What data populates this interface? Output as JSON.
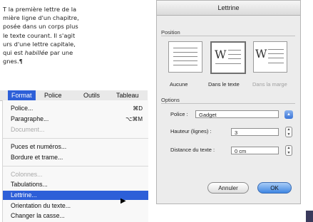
{
  "document": {
    "line1": "T la première lettre de la",
    "line2": "mière ligne d'un chapitre,",
    "line3": "posée dans un corps plus",
    "line4": "le texte courant. Il s'agit",
    "line5": "urs d'une lettre capitale,",
    "line6_before": "qui est ",
    "line6_em": "habillée",
    "line6_after": " par une",
    "line7": "gnes.¶"
  },
  "menubar": {
    "format": "Format",
    "police": "Police",
    "outils": "Outils",
    "tableau": "Tableau"
  },
  "menu": {
    "items": [
      {
        "label": "Police...",
        "shortcut": "⌘D"
      },
      {
        "label": "Paragraphe...",
        "shortcut": "⌥⌘M"
      },
      {
        "label": "Document...",
        "shortcut": ""
      },
      {
        "label": "Puces et numéros...",
        "shortcut": ""
      },
      {
        "label": "Bordure et trame...",
        "shortcut": ""
      },
      {
        "label": "Colonnes...",
        "shortcut": ""
      },
      {
        "label": "Tabulations...",
        "shortcut": ""
      },
      {
        "label": "Lettrine...",
        "shortcut": ""
      },
      {
        "label": "Orientation du texte...",
        "shortcut": ""
      },
      {
        "label": "Changer la casse...",
        "shortcut": ""
      }
    ]
  },
  "dialog": {
    "title": "Lettrine",
    "position_label": "Position",
    "options_label": "Options",
    "positions": [
      {
        "label": "Aucune"
      },
      {
        "label": "Dans le texte",
        "letter": "W"
      },
      {
        "label": "Dans la marge",
        "letter": "W"
      }
    ],
    "police_label": "Police :",
    "police_value": "Gadget",
    "hauteur_label": "Hauteur (lignes) :",
    "hauteur_value": "3",
    "distance_label": "Distance du texte :",
    "distance_value": "0 cm",
    "cancel_label": "Annuler",
    "ok_label": "OK"
  },
  "icons": {
    "stepper": "stepper-arrows-icon",
    "select": "select-arrows-icon",
    "cursor": "mouse-pointer-icon"
  },
  "colors": {
    "menu_highlight": "#2d5fd8",
    "ok_button": "#3f86e2"
  }
}
